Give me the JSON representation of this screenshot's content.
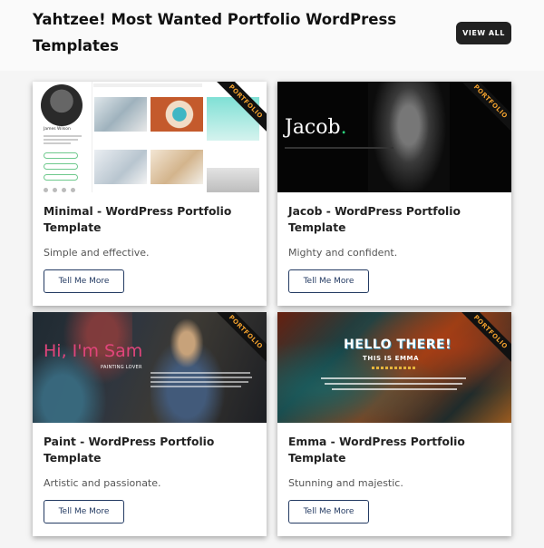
{
  "header": {
    "title": "Yahtzee! Most Wanted Portfolio WordPress Templates",
    "view_all_label": "VIEW ALL"
  },
  "ribbon_label": "PORTFOLIO",
  "cards": [
    {
      "title": "Minimal - WordPress Portfolio Template",
      "description": "Simple and effective.",
      "button_label": "Tell Me More",
      "thumb": {
        "name": "James Wilson",
        "captions": [
          "Minimalist",
          "Ad Hoc Mess",
          "Mixed-up",
          "Catch all"
        ]
      }
    },
    {
      "title": "Jacob - WordPress Portfolio Template",
      "description": "Mighty and confident.",
      "button_label": "Tell Me More",
      "thumb": {
        "logo": "Jacob",
        "logo_dot": "."
      }
    },
    {
      "title": "Paint - WordPress Portfolio Template",
      "description": "Artistic and passionate.",
      "button_label": "Tell Me More",
      "thumb": {
        "headline": "Hi, I'm Sam",
        "subline": "PAINTING LOVER"
      }
    },
    {
      "title": "Emma - WordPress Portfolio Template",
      "description": "Stunning and majestic.",
      "button_label": "Tell Me More",
      "thumb": {
        "headline": "HELLO THERE!",
        "subline": "THIS IS EMMA"
      }
    }
  ],
  "colors": {
    "button_border": "#233a62",
    "ribbon_text": "#f2a12e",
    "jacob_accent": "#2bd37d",
    "paint_headline": "#e0457b"
  }
}
